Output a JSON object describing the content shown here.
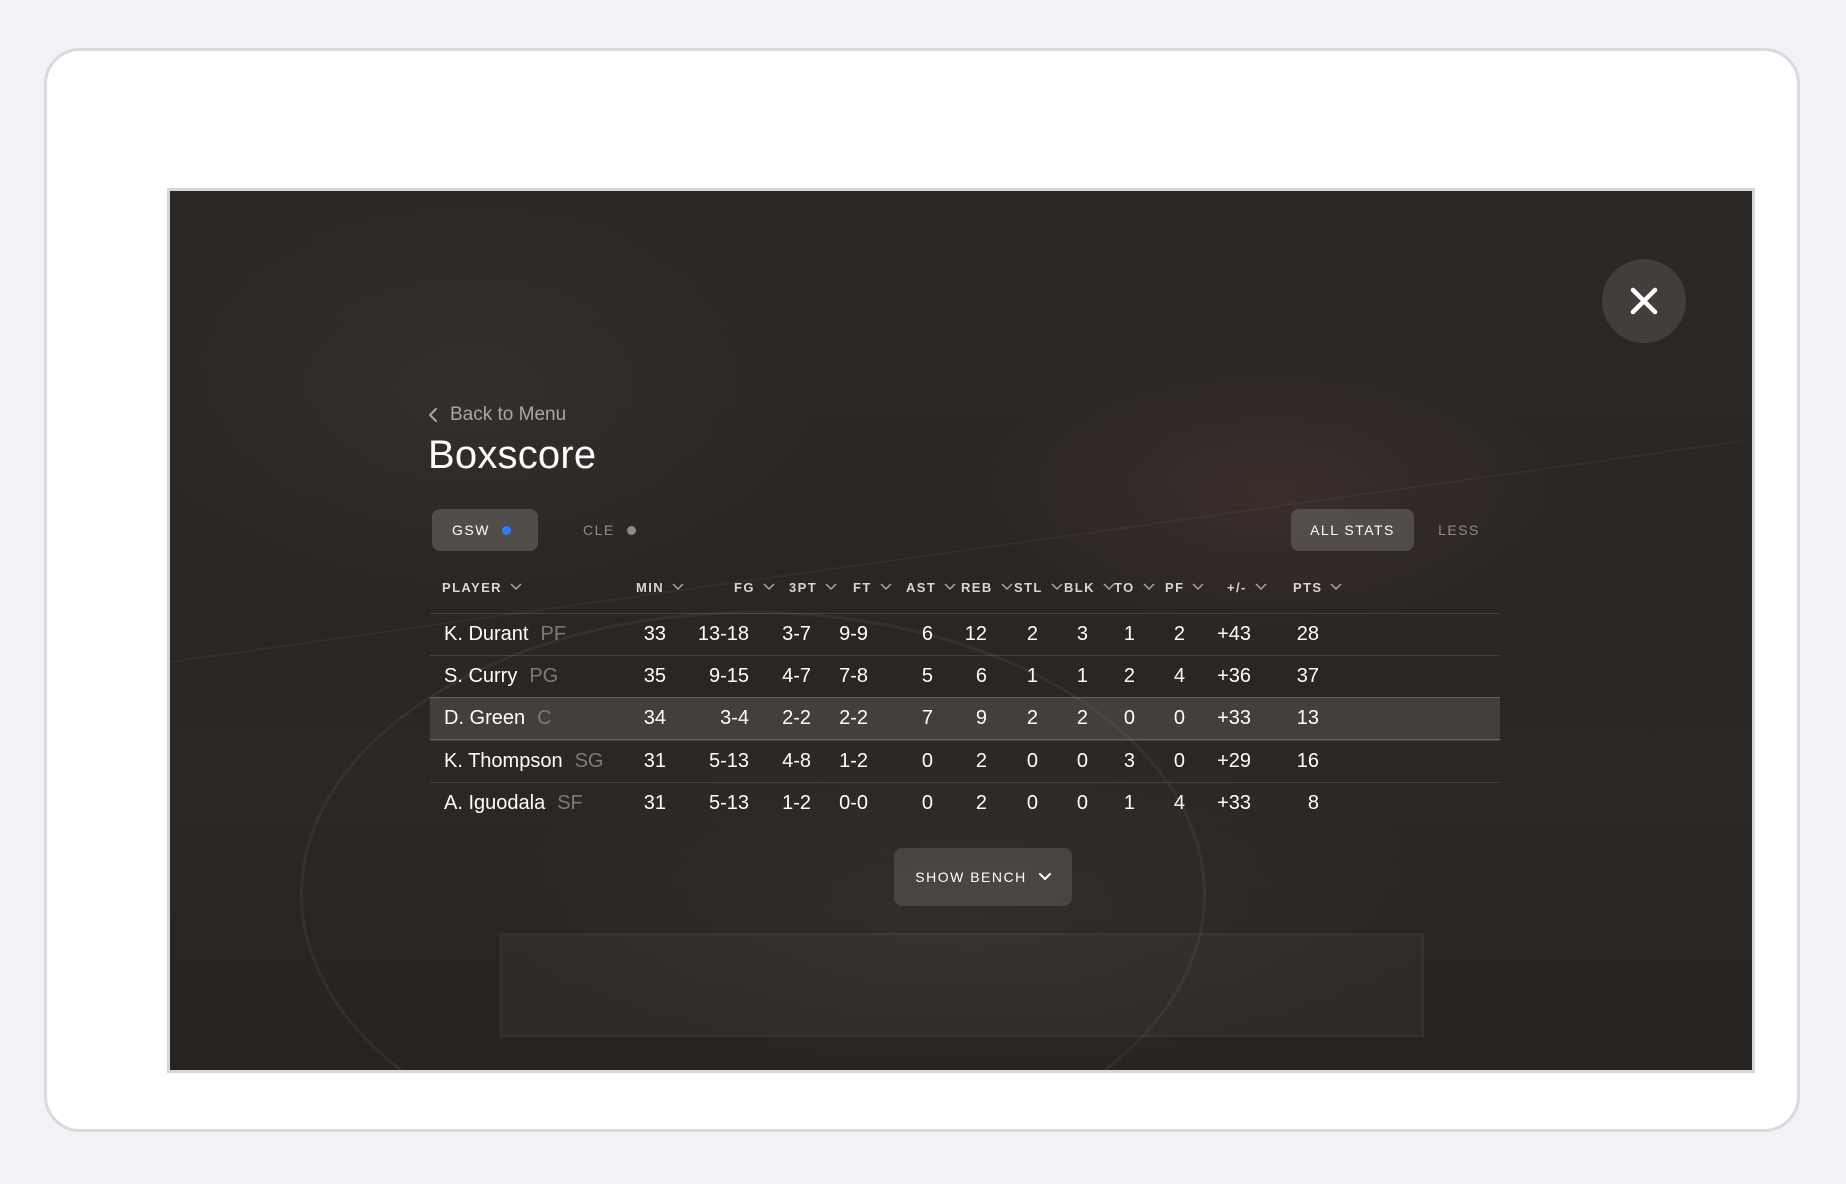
{
  "back_label": "Back to Menu",
  "title": "Boxscore",
  "teams": [
    {
      "label": "GSW",
      "dot_color": "#2f7bff",
      "active": true
    },
    {
      "label": "CLE",
      "dot_color": "#8e8b89",
      "active": false
    }
  ],
  "stats_toggle": {
    "all": "ALL STATS",
    "less": "LESS"
  },
  "columns": [
    "PLAYER",
    "MIN",
    "FG",
    "3PT",
    "FT",
    "AST",
    "REB",
    "STL",
    "BLK",
    "TO",
    "PF",
    "+/-",
    "PTS"
  ],
  "players": [
    {
      "name": "K. Durant",
      "pos": "PF",
      "min": "33",
      "fg": "13-18",
      "tpt": "3-7",
      "ft": "9-9",
      "ast": "6",
      "reb": "12",
      "stl": "2",
      "blk": "3",
      "to": "1",
      "pf": "2",
      "pm": "+43",
      "pts": "28"
    },
    {
      "name": "S. Curry",
      "pos": "PG",
      "min": "35",
      "fg": "9-15",
      "tpt": "4-7",
      "ft": "7-8",
      "ast": "5",
      "reb": "6",
      "stl": "1",
      "blk": "1",
      "to": "2",
      "pf": "4",
      "pm": "+36",
      "pts": "37"
    },
    {
      "name": "D. Green",
      "pos": "C",
      "min": "34",
      "fg": "3-4",
      "tpt": "2-2",
      "ft": "2-2",
      "ast": "7",
      "reb": "9",
      "stl": "2",
      "blk": "2",
      "to": "0",
      "pf": "0",
      "pm": "+33",
      "pts": "13"
    },
    {
      "name": "K. Thompson",
      "pos": "SG",
      "min": "31",
      "fg": "5-13",
      "tpt": "4-8",
      "ft": "1-2",
      "ast": "0",
      "reb": "2",
      "stl": "0",
      "blk": "0",
      "to": "3",
      "pf": "0",
      "pm": "+29",
      "pts": "16"
    },
    {
      "name": "A. Iguodala",
      "pos": "SF",
      "min": "31",
      "fg": "5-13",
      "tpt": "1-2",
      "ft": "0-0",
      "ast": "0",
      "reb": "2",
      "stl": "0",
      "blk": "0",
      "to": "1",
      "pf": "4",
      "pm": "+33",
      "pts": "8"
    }
  ],
  "highlighted_row": 2,
  "show_bench_label": "SHOW BENCH",
  "icons": {
    "close": "close-icon",
    "back": "chevron-left-icon",
    "sort": "chevron-down-icon",
    "bench": "chevron-down-icon"
  }
}
